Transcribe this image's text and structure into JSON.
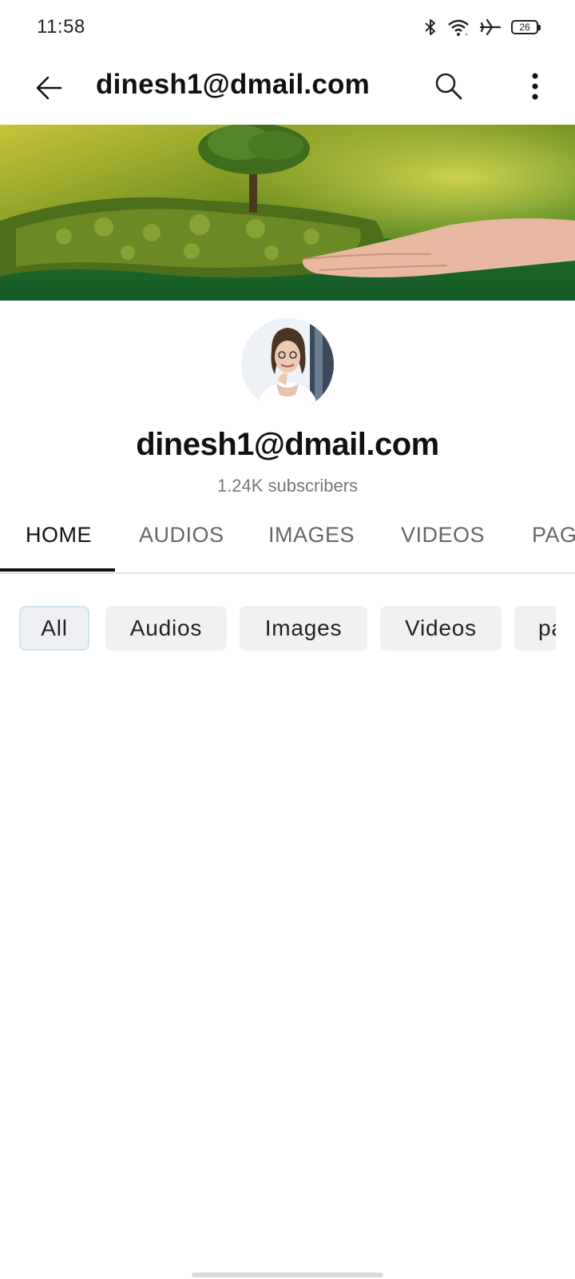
{
  "status_bar": {
    "time": "11:58",
    "icons": [
      "bluetooth-icon",
      "wifi-icon",
      "airplane-mode-icon",
      "battery-icon"
    ],
    "battery_level": "26"
  },
  "app_bar": {
    "title": "dinesh1@dmail.com",
    "back_icon": "arrow-left-icon",
    "search_icon": "search-icon",
    "more_icon": "more-vertical-icon"
  },
  "channel": {
    "name": "dinesh1@dmail.com",
    "subscribers": "1.24K subscribers"
  },
  "tabs": [
    {
      "label": "HOME",
      "active": true
    },
    {
      "label": "AUDIOS",
      "active": false
    },
    {
      "label": "IMAGES",
      "active": false
    },
    {
      "label": "VIDEOS",
      "active": false
    },
    {
      "label": "PAG",
      "active": false
    }
  ],
  "chips": [
    {
      "label": "All",
      "selected": true
    },
    {
      "label": "Audios",
      "selected": false
    },
    {
      "label": "Images",
      "selected": false
    },
    {
      "label": "Videos",
      "selected": false
    },
    {
      "label": "pa",
      "selected": false
    }
  ],
  "colors": {
    "accent": "#111111",
    "chip_bg": "#f1f1f1",
    "chip_selected_border": "#cfe6f3",
    "muted_text": "#777777"
  }
}
